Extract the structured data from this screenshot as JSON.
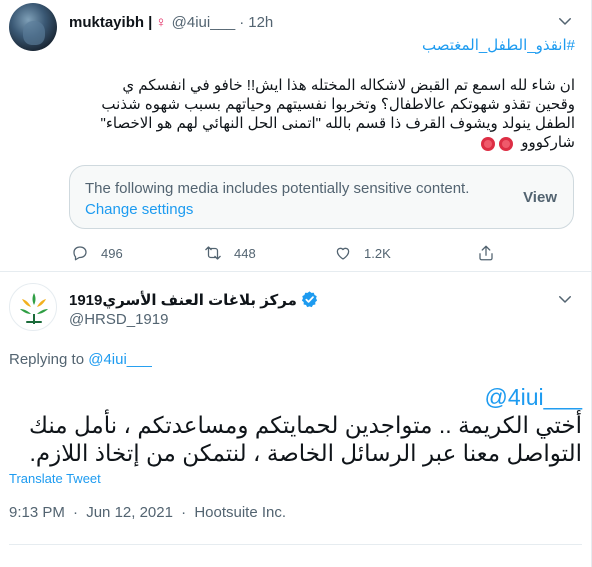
{
  "reply_tweet": {
    "author_name": "muktayibh |",
    "gender_symbol": "♀",
    "handle": "@4iui___",
    "dot": "·",
    "time": "12h",
    "hashtag": "#انقذو_الطفل_المغتصب",
    "lines": [
      "ان شاء لله اسمع تم القبض لاشكاله المختله هذا ايش!! خافو في انفسكم ي",
      "وقحين تقذو شهوتكم عالاطفال؟ وتخربوا نفسيتهم وحياتهم بسبب شهوه شذنب",
      "الطفل ينولد ويشوف القرف ذا قسم بالله \"اتمنى الحل النهائي لهم هو الاخصاء\"",
      "شاركووو"
    ],
    "sensitive_notice": "The following media includes potentially sensitive content.",
    "change_settings": "Change settings",
    "view_label": "View",
    "reply_count": "496",
    "retweet_count": "448",
    "like_count": "1.2K",
    "icons": [
      "reply-icon",
      "retweet-icon",
      "like-icon",
      "share-icon"
    ]
  },
  "main_tweet": {
    "author_name": "مركز بلاغات العنف الأسري1919",
    "handle": "@HRSD_1919",
    "replying_prefix": "Replying to",
    "replying_handle": "@4iui___",
    "mention": "@4iui___",
    "lines": [
      "أختي الكريمة .. متواجدين لحمايتكم ومساعدتكم ، نأمل منك",
      "التواصل معنا عبر الرسائل الخاصة ، لنتمكن من إتخاذ اللازم."
    ],
    "translate_label": "Translate Tweet",
    "time": "9:13 PM",
    "date": "Jun 12, 2021",
    "source": "Hootsuite Inc.",
    "separator": "·"
  },
  "colors": {
    "link": "#1d9bf0",
    "secondary_text": "#536471",
    "verified": "#1d9bf0",
    "heart_red": "#dd2e44"
  }
}
